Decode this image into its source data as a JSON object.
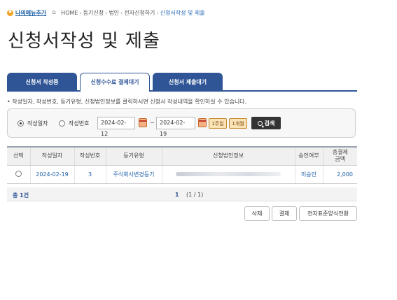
{
  "breadcrumb": {
    "my_menu_add": "나의메뉴추가",
    "home": "HOME",
    "items": [
      "등기신청",
      "법인",
      "전자신청하기"
    ],
    "current": "신청서작성 및 제출"
  },
  "page_title": "신청서작성 및 제출",
  "tabs": [
    {
      "label": "신청서 작성중",
      "active": false
    },
    {
      "label": "신청수수료 결제대기",
      "active": true
    },
    {
      "label": "신청서 제출대기",
      "active": false
    }
  ],
  "notice": "• 작성일자, 작성번호, 등기유형, 신청법인정보를 클릭하시면 신청서 작성내역을 확인하실 수 있습니다.",
  "search": {
    "radio_date": "작성일자",
    "radio_number": "작성번호",
    "radio_selected": "작성일자",
    "date_from": "2024-02-12",
    "tilde": "~",
    "date_to": "2024-02-19",
    "btn_week": "1주일",
    "btn_month": "1개월",
    "btn_search": "검색"
  },
  "table": {
    "headers": [
      "선택",
      "작성일자",
      "작성번호",
      "등기유형",
      "신청법인정보",
      "승인여부",
      "총결제\n금액"
    ],
    "header_amount_line1": "총결제",
    "header_amount_line2": "금액",
    "rows": [
      {
        "date": "2024-02-19",
        "number": "3",
        "type": "주식회사변경등기",
        "corp_info": "",
        "approval": "미승인",
        "amount": "2,000"
      }
    ]
  },
  "summary": {
    "total_prefix": "총",
    "total_count": "1",
    "total_suffix": "건",
    "page_current": "1",
    "page_info": "(1 / 1)"
  },
  "actions": {
    "delete": "삭제",
    "pay": "결제",
    "convert": "전자표준양식전환"
  },
  "colors": {
    "tab_blue": "#2f5597",
    "link_blue": "#1d5fa8",
    "period_btn": "#fbe3b8"
  }
}
